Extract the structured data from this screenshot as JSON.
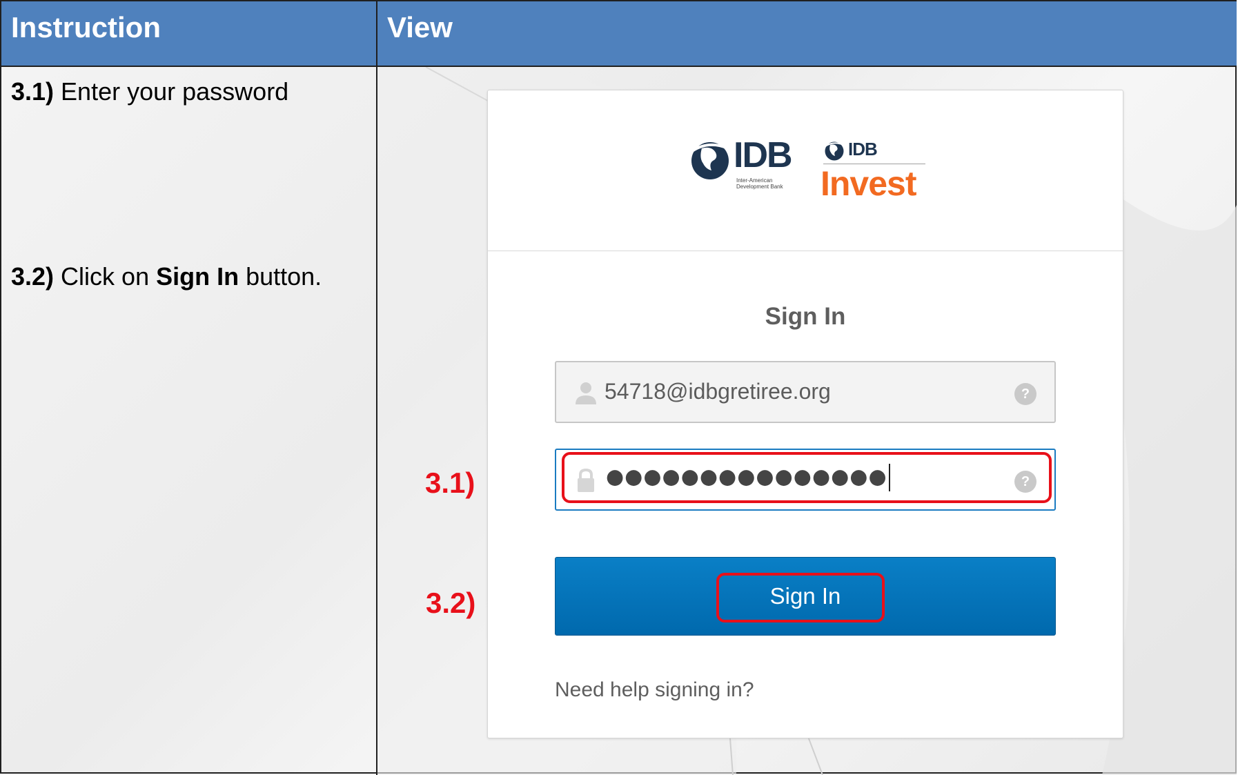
{
  "header": {
    "instruction": "Instruction",
    "view": "View"
  },
  "instructions": [
    {
      "step": "3.1)",
      "text": " Enter your password"
    },
    {
      "step": "3.2)",
      "text_before": " Click on ",
      "bold": "Sign In",
      "text_after": " button."
    }
  ],
  "login": {
    "logo_idb": "IDB",
    "logo_idb_sub": "Inter-American Development Bank",
    "logo_idb_small": "IDB",
    "logo_invest": "Invest",
    "title": "Sign In",
    "username_value": "54718@idbgretiree.org",
    "password_dots": "●●●●●●●●●●●●●●●",
    "help_glyph": "?",
    "signin_button": "Sign In",
    "help_link": "Need help signing in?"
  },
  "annotations": {
    "step1_label": "3.1)",
    "step2_label": "3.2)",
    "color": "#e8101a"
  },
  "colors": {
    "header_bg": "#4f81bd",
    "button_bg": "#0a7fc6",
    "invest_orange": "#f26a21",
    "idb_navy": "#1e3550"
  },
  "icons": {
    "user": "user-icon",
    "lock": "lock-icon",
    "help": "help-icon",
    "globe": "globe-logo-icon"
  }
}
